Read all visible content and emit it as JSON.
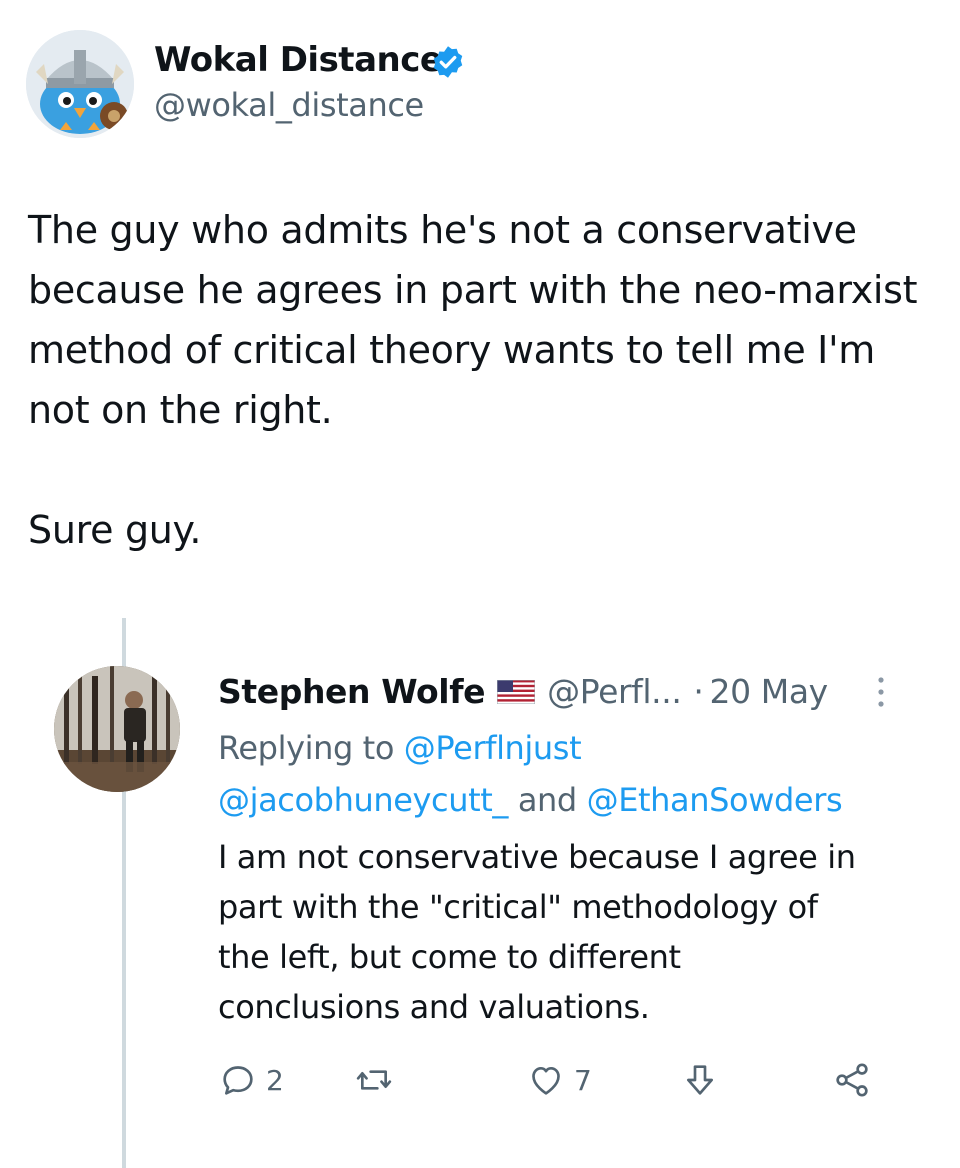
{
  "tweet": {
    "author": {
      "name": "Wokal Distance",
      "handle": "@wokal_distance",
      "avatar_icon": "viking-bird-avatar",
      "verified_icon": "verified-badge-icon"
    },
    "text_lines": [
      "The guy who admits he's not a conservative",
      "because he agrees in part with the neo-marxist",
      "method of critical theory wants to tell me I'm",
      "not on the right.",
      "Sure guy."
    ]
  },
  "quoted": {
    "author_name": "Stephen Wolfe",
    "flag_icon": "us-flag-icon",
    "handle": "@Perfl...",
    "separator": "·",
    "date": "20 May",
    "reply_prefix": "Replying to",
    "reply_mention_1": "@Perflnjust",
    "reply_mention_2": "@jacobhuneycutt_",
    "reply_and": "and",
    "reply_mention_3": "@EthanSowders",
    "text_lines": [
      "I am not conservative because I agree in",
      "part with the \"critical\" methodology of",
      "the left, but come to different",
      "conclusions and valuations."
    ],
    "actions": {
      "reply_count": "2",
      "like_count": "7"
    }
  },
  "colors": {
    "text": "#0f1419",
    "muted": "#536471",
    "link": "#1d9bf0",
    "thread_line": "#cfd9de"
  }
}
